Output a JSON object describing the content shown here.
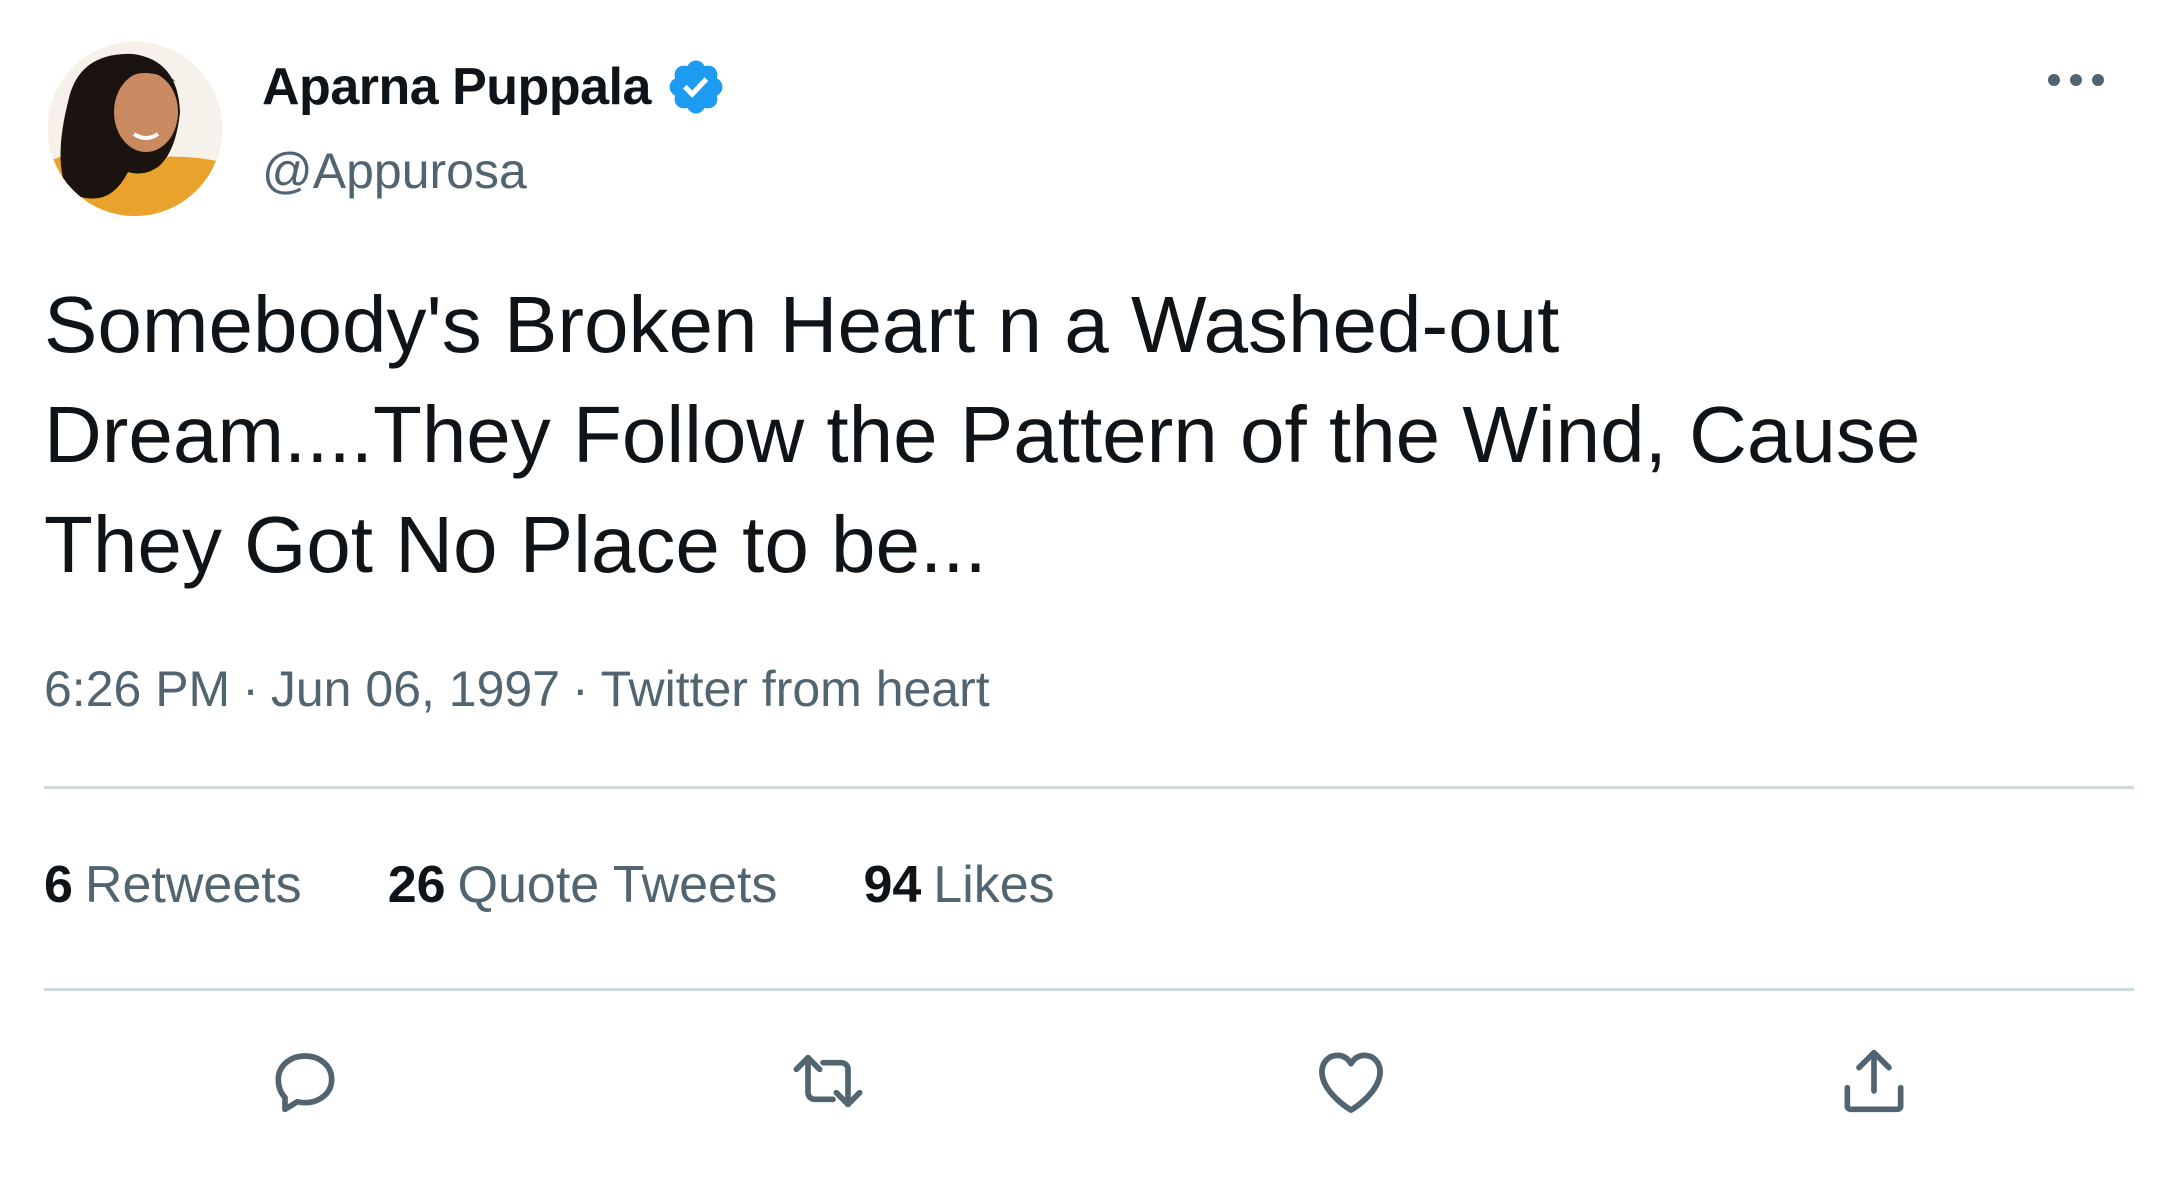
{
  "author": {
    "display_name": "Aparna Puppala",
    "handle": "@Appurosa",
    "verified": true,
    "avatar_icon": "user-avatar-photo"
  },
  "tweet": {
    "text_lines": [
      "Somebody's Broken Heart n a Washed-out",
      "Dream....They Follow the Pattern of the Wind, Cause",
      "They Got No Place to be..."
    ],
    "time": "6:26 PM",
    "date": "Jun 06, 1997",
    "source": "Twitter from heart",
    "separator": "·"
  },
  "stats": {
    "retweets": {
      "count": "6",
      "label": "Retweets"
    },
    "quote_tweets": {
      "count": "26",
      "label": "Quote Tweets"
    },
    "likes": {
      "count": "94",
      "label": "Likes"
    }
  },
  "actions": [
    "reply-icon",
    "retweet-icon",
    "like-icon",
    "share-icon"
  ],
  "colors": {
    "text": "#0f1419",
    "secondary": "#536471",
    "divider": "#cfd9de",
    "verified_blue": "#1d9bf0"
  }
}
